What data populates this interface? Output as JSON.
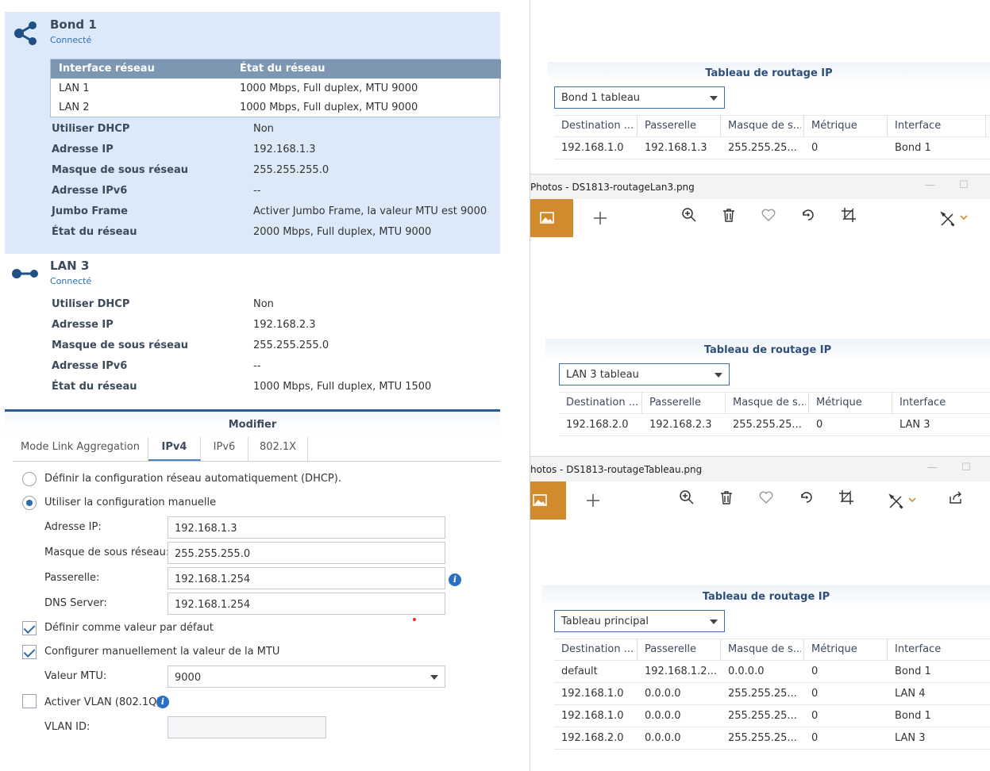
{
  "bond": {
    "name": "Bond 1",
    "status": "Connecté",
    "table_headers": [
      "Interface réseau",
      "État du réseau"
    ],
    "members": [
      {
        "iface": "LAN 1",
        "state": "1000 Mbps, Full duplex, MTU 9000"
      },
      {
        "iface": "LAN 2",
        "state": "1000 Mbps, Full duplex, MTU 9000"
      }
    ],
    "props": [
      {
        "label": "Utiliser DHCP",
        "value": "Non"
      },
      {
        "label": "Adresse IP",
        "value": "192.168.1.3"
      },
      {
        "label": "Masque de sous réseau",
        "value": "255.255.255.0"
      },
      {
        "label": "Adresse IPv6",
        "value": "--"
      },
      {
        "label": "Jumbo Frame",
        "value": "Activer Jumbo Frame, la valeur MTU est 9000"
      },
      {
        "label": "État du réseau",
        "value": "2000 Mbps, Full duplex, MTU 9000"
      }
    ]
  },
  "lan3": {
    "name": "LAN 3",
    "status": "Connecté",
    "props": [
      {
        "label": "Utiliser DHCP",
        "value": "Non"
      },
      {
        "label": "Adresse IP",
        "value": "192.168.2.3"
      },
      {
        "label": "Masque de sous réseau",
        "value": "255.255.255.0"
      },
      {
        "label": "Adresse IPv6",
        "value": "--"
      },
      {
        "label": "État du réseau",
        "value": "1000 Mbps, Full duplex, MTU 1500"
      }
    ]
  },
  "modify": {
    "title": "Modifier",
    "tabs": [
      "Mode Link Aggregation",
      "IPv4",
      "IPv6",
      "802.1X"
    ],
    "active_tab": "IPv4",
    "radio_dhcp": "Définir la configuration réseau automatiquement (DHCP).",
    "radio_manual": "Utiliser la configuration manuelle",
    "fields": [
      {
        "label": "Adresse IP:",
        "value": "192.168.1.3"
      },
      {
        "label": "Masque de sous réseau:",
        "value": "255.255.255.0"
      },
      {
        "label": "Passerelle:",
        "value": "192.168.1.254"
      },
      {
        "label": "DNS Server:",
        "value": "192.168.1.254"
      }
    ],
    "check_default": "Définir comme valeur par défaut",
    "check_mtu": "Configurer manuellement la valeur de la MTU",
    "mtu_label": "Valeur MTU:",
    "mtu_value": "9000",
    "check_vlan": "Activer VLAN (802.1Q)",
    "vlan_label": "VLAN ID:",
    "vlan_value": ""
  },
  "routing": {
    "title": "Tableau de routage IP",
    "columns": [
      "Destination ...",
      "Passerelle",
      "Masque de s...",
      "Métrique",
      "Interface"
    ],
    "panel1": {
      "selected": "Bond 1 tableau",
      "rows": [
        [
          "192.168.1.0",
          "192.168.1.3",
          "255.255.25...",
          "0",
          "Bond 1"
        ]
      ]
    },
    "panel2": {
      "selected": "LAN 3 tableau",
      "rows": [
        [
          "192.168.2.0",
          "192.168.2.3",
          "255.255.25...",
          "0",
          "LAN 3"
        ]
      ]
    },
    "panel3": {
      "selected": "Tableau principal",
      "rows": [
        [
          "default",
          "192.168.1.2...",
          "0.0.0.0",
          "0",
          "Bond 1"
        ],
        [
          "192.168.1.0",
          "0.0.0.0",
          "255.255.25...",
          "0",
          "LAN 4"
        ],
        [
          "192.168.1.0",
          "0.0.0.0",
          "255.255.25...",
          "0",
          "Bond 1"
        ],
        [
          "192.168.2.0",
          "0.0.0.0",
          "255.255.25...",
          "0",
          "LAN 3"
        ]
      ]
    }
  },
  "windows": {
    "win1_title": "Photos - DS1813-routageLan3.png",
    "win2_title": "hotos - DS1813-routageTableau.png",
    "minimize": "—",
    "maximize": "☐"
  },
  "colors": {
    "accent_blue": "#2d6ab0",
    "photo_orange": "#d18b2c",
    "bond_bg": "#dce9f9"
  }
}
